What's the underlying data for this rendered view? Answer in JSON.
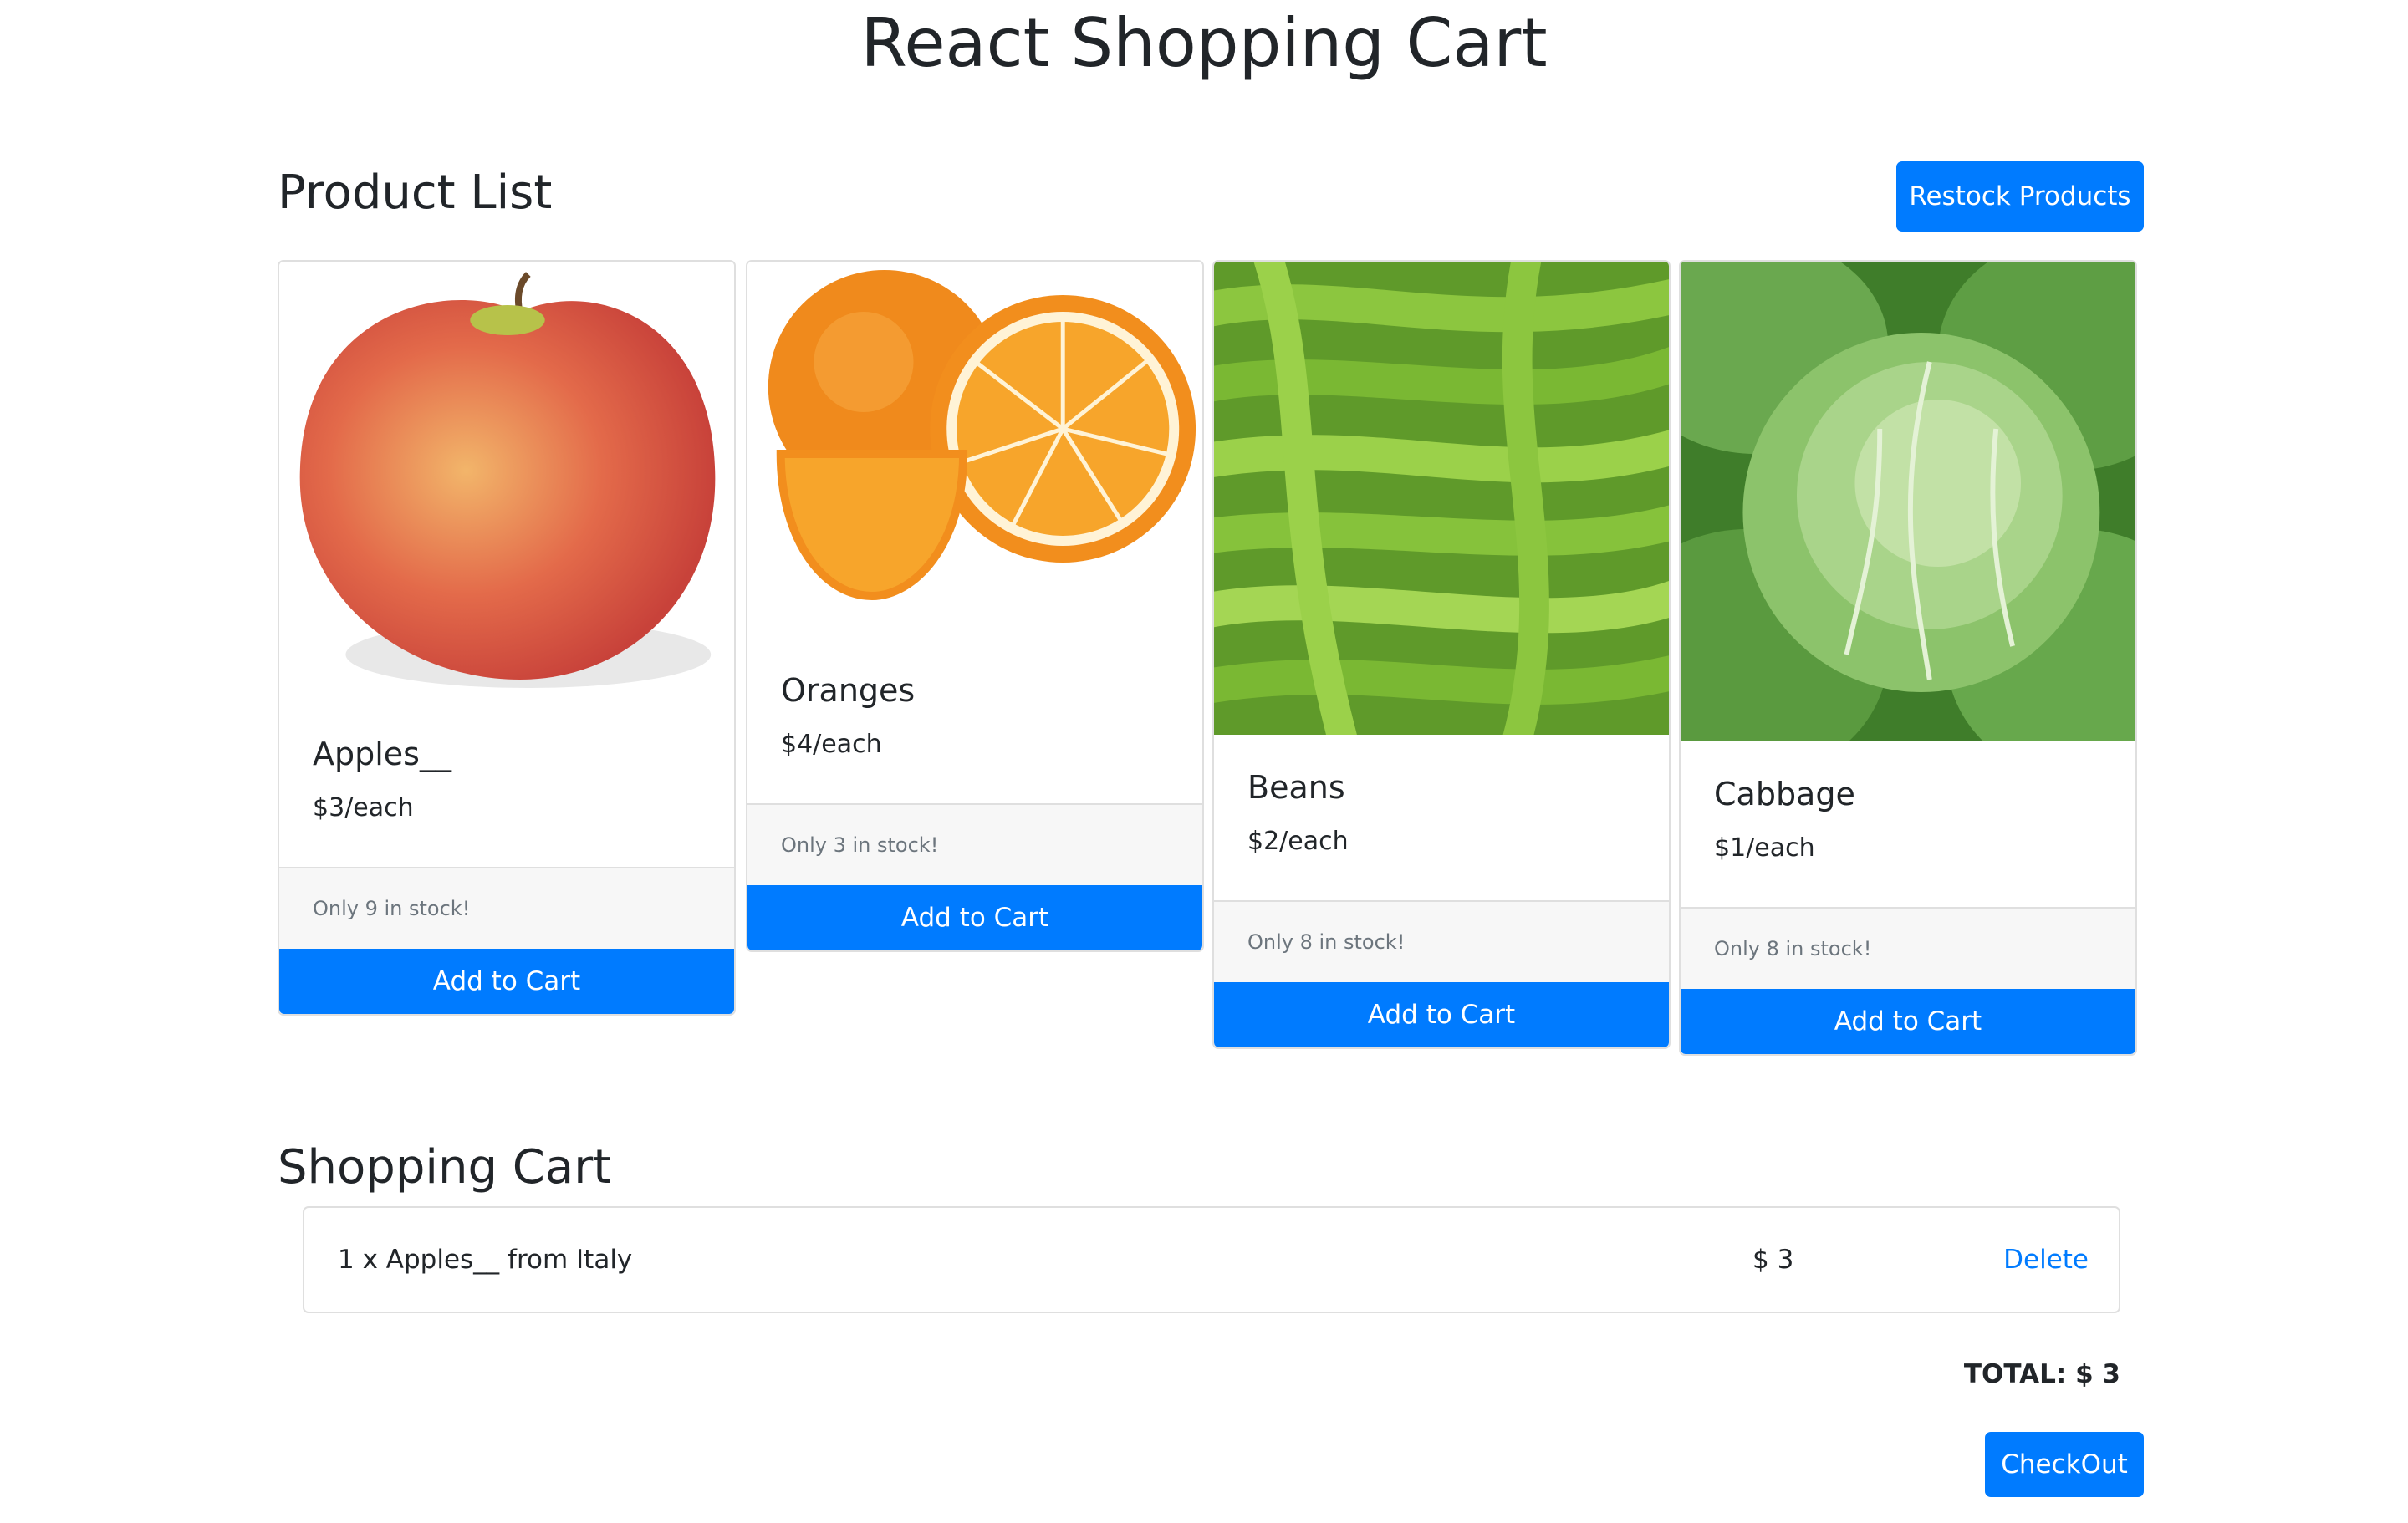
{
  "app": {
    "title": "React Shopping Cart"
  },
  "product_list": {
    "heading": "Product List",
    "restock_label": "Restock Products",
    "add_to_cart_label": "Add to Cart",
    "products": [
      {
        "name": "Apples__",
        "price": "$3/each",
        "stock": "Only 9 in stock!",
        "image": "apple"
      },
      {
        "name": "Oranges",
        "price": "$4/each",
        "stock": "Only 3 in stock!",
        "image": "oranges"
      },
      {
        "name": "Beans",
        "price": "$2/each",
        "stock": "Only 8 in stock!",
        "image": "green-beans"
      },
      {
        "name": "Cabbage",
        "price": "$1/each",
        "stock": "Only 8 in stock!",
        "image": "cabbage"
      }
    ]
  },
  "shopping_cart": {
    "heading": "Shopping Cart",
    "items": [
      {
        "description": "1 x Apples__ from Italy",
        "price": "$ 3",
        "delete_label": "Delete"
      }
    ],
    "total": "TOTAL: $ 3",
    "checkout_label": "CheckOut"
  },
  "colors": {
    "primary": "#007bff",
    "border": "#dfdfdf",
    "footer_bg": "#f7f7f7",
    "muted": "#6c757d"
  }
}
